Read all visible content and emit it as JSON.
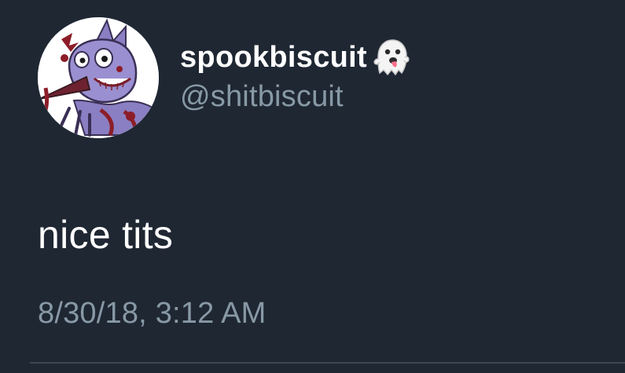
{
  "tweet": {
    "display_name": "spookbiscuit",
    "name_emoji": "ghost-emoji",
    "handle": "@shitbiscuit",
    "text": "nice tits",
    "timestamp": "8/30/18, 3:12 AM"
  },
  "avatar": {
    "icon": "cartoon-bird-avatar"
  },
  "colors": {
    "background": "#1f2733",
    "primary_text": "#ffffff",
    "secondary_text": "#8899a6",
    "divider": "#3d4753"
  }
}
